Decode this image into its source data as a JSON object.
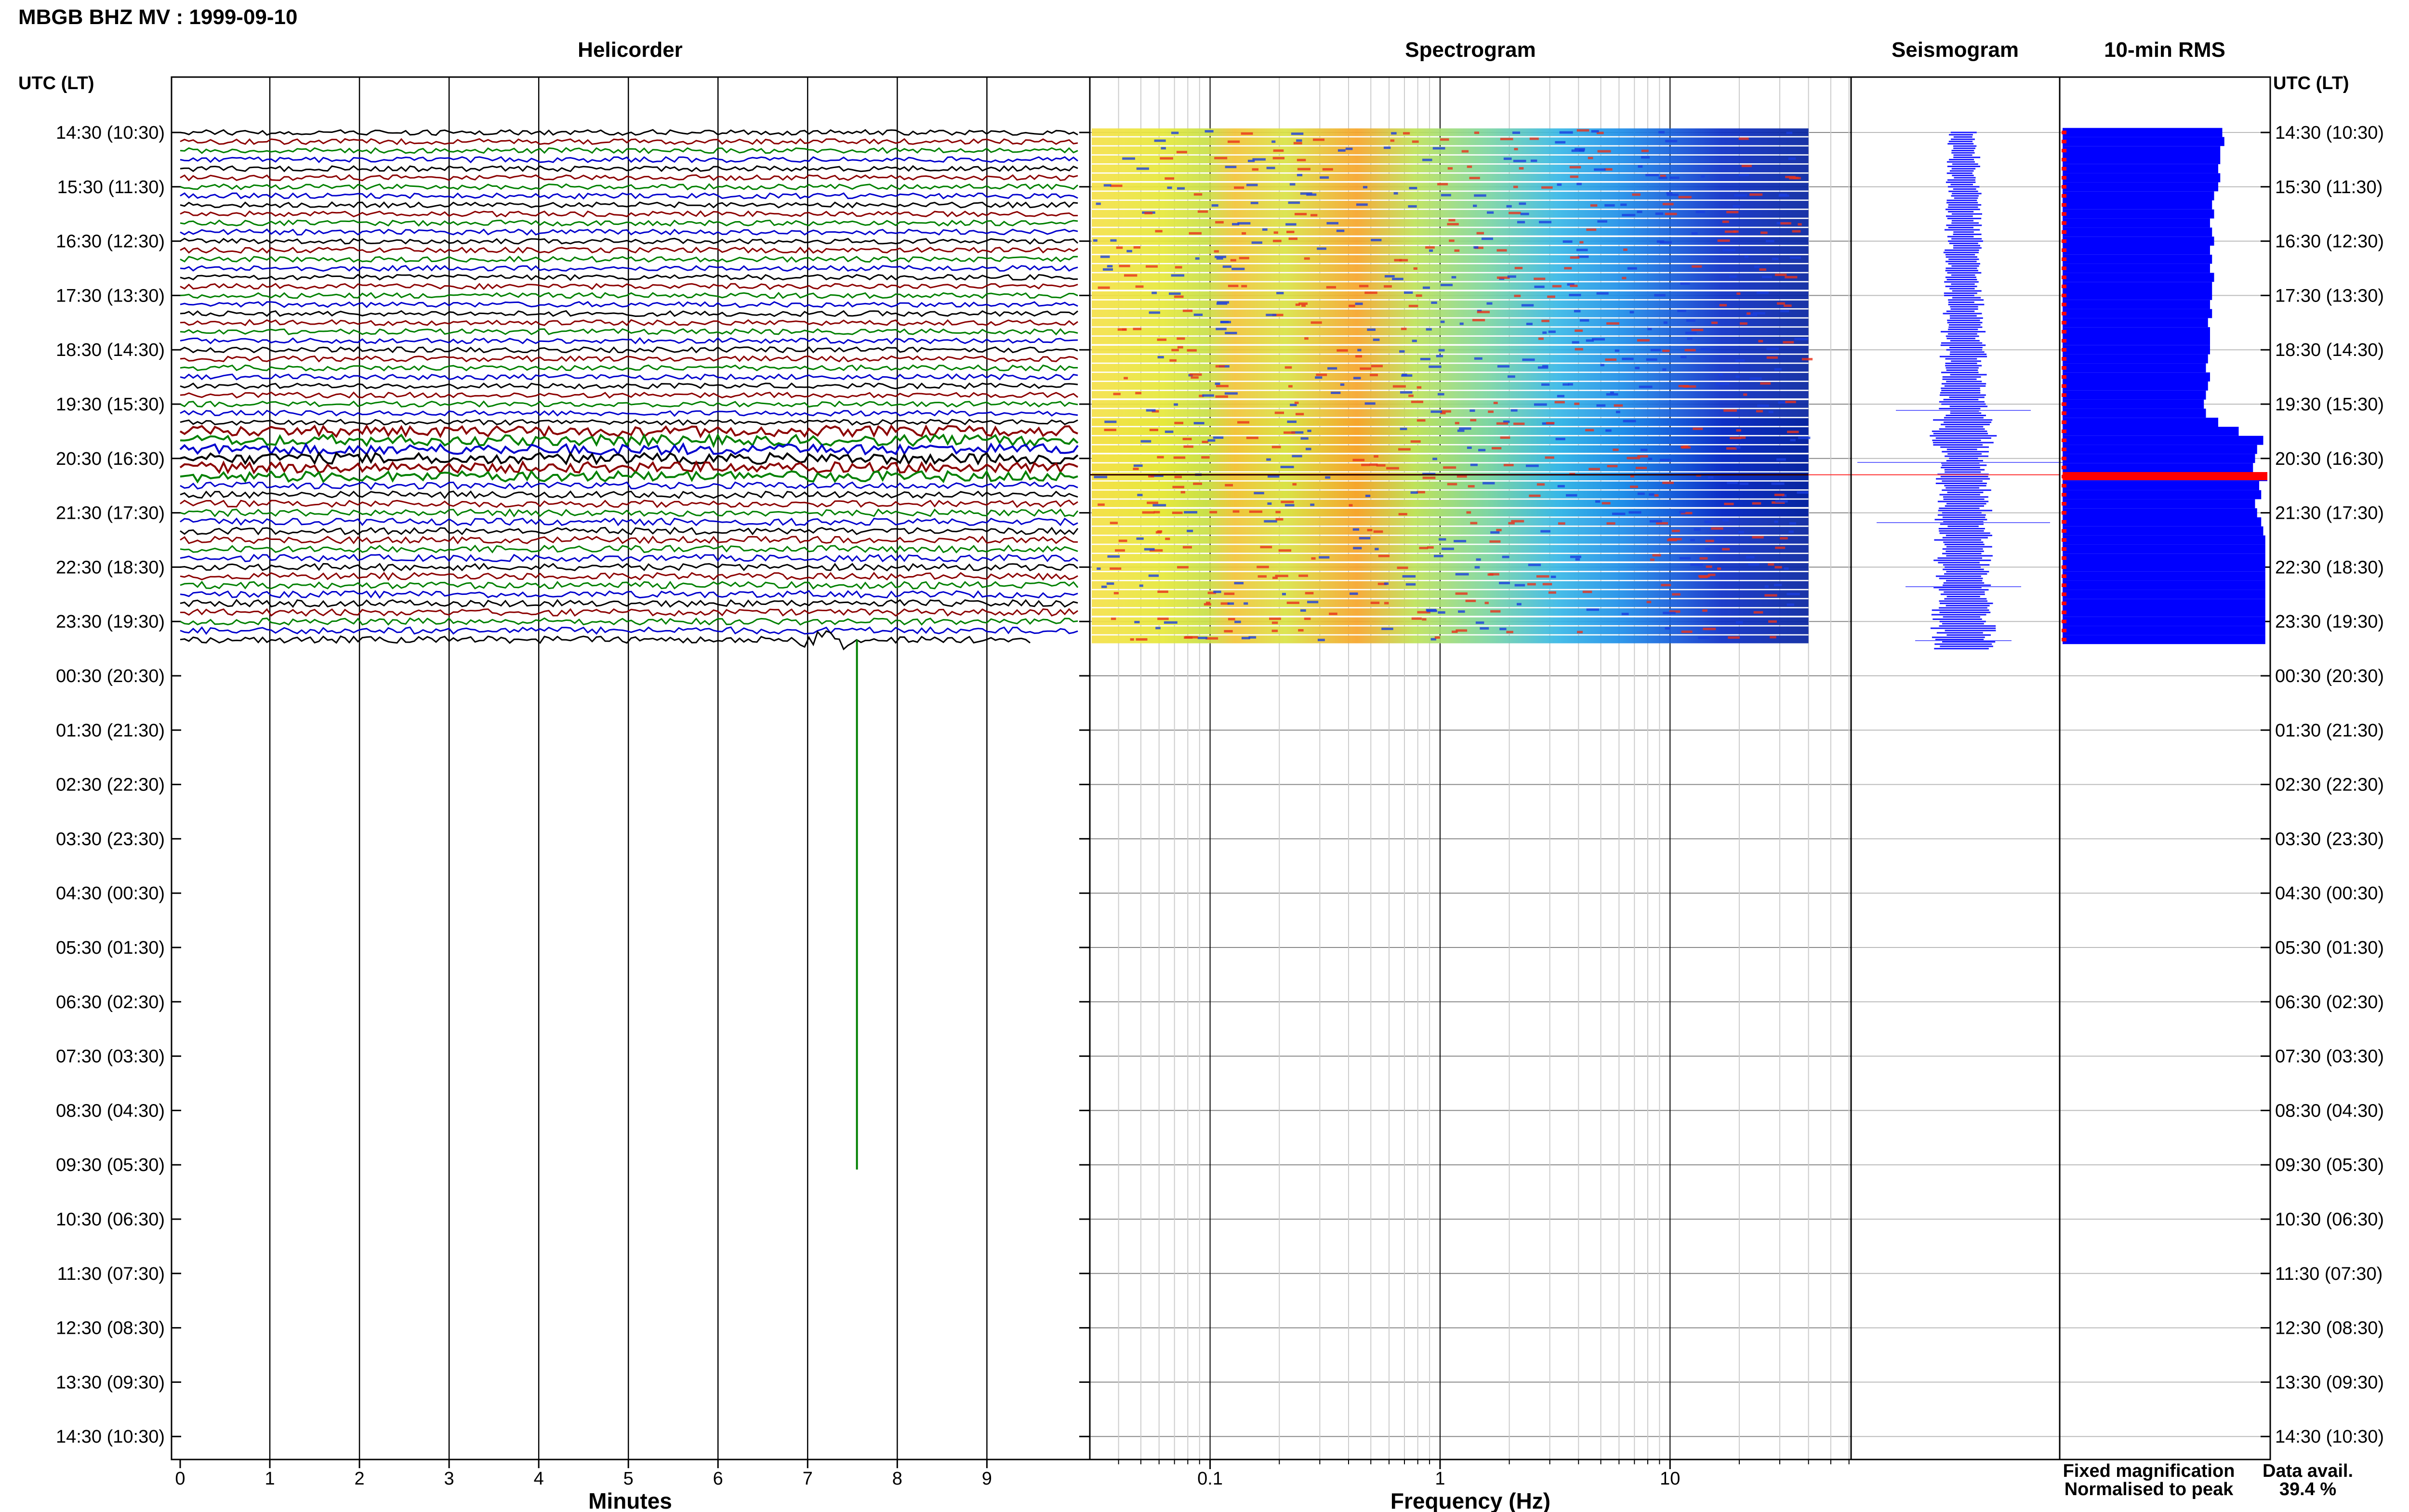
{
  "header": {
    "title": "MBGB BHZ MV : 1999-09-10",
    "utc_lt_left": "UTC (LT)",
    "utc_lt_right": "UTC (LT)"
  },
  "panels": {
    "helicorder": "Helicorder",
    "spectrogram": "Spectrogram",
    "seismogram": "Seismogram",
    "rms": "10-min RMS"
  },
  "axes": {
    "minutes_title": "Minutes",
    "minute_ticks": [
      "0",
      "1",
      "2",
      "3",
      "4",
      "5",
      "6",
      "7",
      "8",
      "9"
    ],
    "frequency_title": "Frequency (Hz)",
    "frequency_ticks": [
      "0.1",
      "1",
      "10"
    ]
  },
  "time_labels": [
    "14:30 (10:30)",
    "15:30 (11:30)",
    "16:30 (12:30)",
    "17:30 (13:30)",
    "18:30 (14:30)",
    "19:30 (15:30)",
    "20:30 (16:30)",
    "21:30 (17:30)",
    "22:30 (18:30)",
    "23:30 (19:30)",
    "00:30 (20:30)",
    "01:30 (21:30)",
    "02:30 (22:30)",
    "03:30 (23:30)",
    "04:30 (00:30)",
    "05:30 (01:30)",
    "06:30 (02:30)",
    "07:30 (03:30)",
    "08:30 (04:30)",
    "09:30 (05:30)",
    "10:30 (06:30)",
    "11:30 (07:30)",
    "12:30 (08:30)",
    "13:30 (09:30)",
    "14:30 (10:30)"
  ],
  "legend": {
    "fixed": "Fixed magnification",
    "normalised": "Normalised to peak",
    "fixed_color": "#0000ff",
    "normalised_color": "#ff0000"
  },
  "data_avail": {
    "label": "Data avail.",
    "value": "39.4 %"
  },
  "chart_data": {
    "type": "heatmap",
    "station": "MBGB BHZ MV",
    "date": "1999-09-10",
    "data_hours": 9.5,
    "helicorder_colors": [
      "#000000",
      "#8b0000",
      "#008000",
      "#0000cd"
    ],
    "frequency_range_hz": [
      0.025,
      40
    ],
    "rms_10min_relative": [
      0.78,
      0.79,
      0.77,
      0.77,
      0.76,
      0.77,
      0.76,
      0.74,
      0.73,
      0.74,
      0.72,
      0.73,
      0.74,
      0.72,
      0.73,
      0.72,
      0.74,
      0.73,
      0.73,
      0.72,
      0.73,
      0.71,
      0.72,
      0.72,
      0.72,
      0.71,
      0.7,
      0.72,
      0.71,
      0.7,
      0.69,
      0.7,
      0.76,
      0.86,
      0.98,
      0.95,
      0.94,
      0.93,
      1.0,
      0.96,
      0.97,
      0.94,
      0.95,
      0.97,
      0.98,
      0.99,
      0.99,
      0.99,
      0.99,
      0.99,
      0.99,
      0.99,
      0.99,
      0.99,
      0.99,
      0.99,
      0.99
    ],
    "rms_peak_row": 38,
    "spike_minute": 7.55
  }
}
